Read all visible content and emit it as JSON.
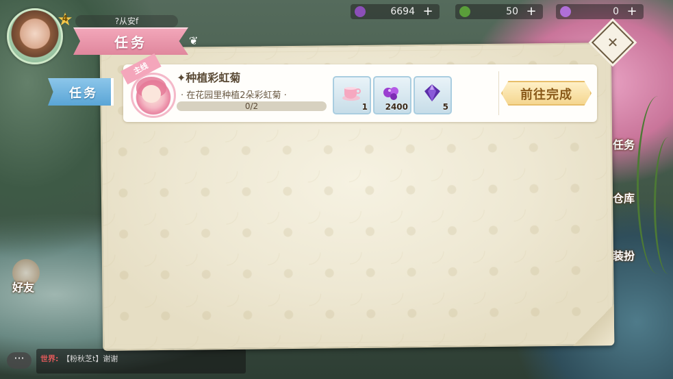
{
  "header": {
    "level": "4",
    "player_name": "?从安f",
    "resources": [
      {
        "icon": "grape-icon",
        "value": "6694",
        "plus": "+"
      },
      {
        "icon": "leaf-icon",
        "value": "50",
        "plus": "+"
      },
      {
        "icon": "gem-cluster-icon",
        "value": "0",
        "plus": "+"
      }
    ]
  },
  "panel": {
    "title": "任务",
    "tab": "任务",
    "quest": {
      "tag": "主线",
      "title": "✦种植彩虹菊",
      "description": "· 在花园里种植2朵彩虹菊 ·",
      "progress_text": "0/2",
      "progress": 0,
      "rewards": [
        {
          "icon": "teacup-icon",
          "count": "1"
        },
        {
          "icon": "purple-gems-icon",
          "count": "2400"
        },
        {
          "icon": "purple-crystal-icon",
          "count": "5"
        }
      ],
      "go_button": "前往完成"
    }
  },
  "sidebar": {
    "left": "好友",
    "right": [
      "任务",
      "仓库",
      "装扮"
    ]
  },
  "chat": {
    "prefix": "世界:",
    "message": "【粉秋芝t】谢谢",
    "button": "···"
  },
  "colors": {
    "title_ribbon": "#e0879d",
    "tab": "#5aa5d6",
    "go_button": "#f4d58d",
    "progress_fill": "#a8d36a"
  }
}
